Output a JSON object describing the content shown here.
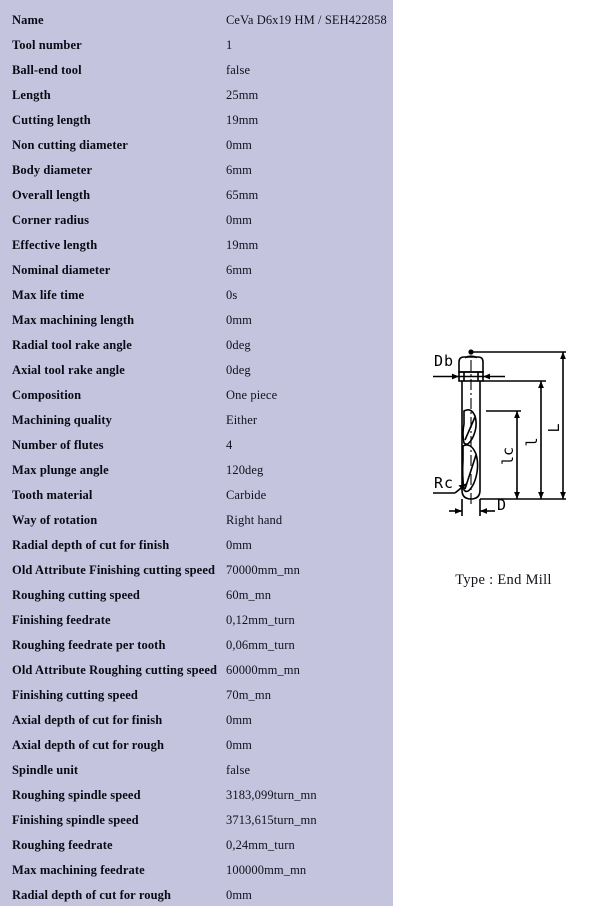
{
  "table": {
    "rows": [
      {
        "label": "Name",
        "value": "CeVa D6x19 HM / SEH422858"
      },
      {
        "label": "Tool number",
        "value": "1"
      },
      {
        "label": "Ball-end tool",
        "value": "false"
      },
      {
        "label": "Length",
        "value": "25mm"
      },
      {
        "label": "Cutting length",
        "value": "19mm"
      },
      {
        "label": "Non cutting diameter",
        "value": "0mm"
      },
      {
        "label": "Body diameter",
        "value": "6mm"
      },
      {
        "label": "Overall length",
        "value": "65mm"
      },
      {
        "label": "Corner radius",
        "value": "0mm"
      },
      {
        "label": "Effective length",
        "value": "19mm"
      },
      {
        "label": "Nominal diameter",
        "value": "6mm"
      },
      {
        "label": "Max life time",
        "value": "0s"
      },
      {
        "label": "Max machining length",
        "value": "0mm"
      },
      {
        "label": "Radial tool rake angle",
        "value": "0deg"
      },
      {
        "label": "Axial tool rake angle",
        "value": "0deg"
      },
      {
        "label": "Composition",
        "value": "One piece"
      },
      {
        "label": "Machining quality",
        "value": "Either"
      },
      {
        "label": "Number of flutes",
        "value": "4"
      },
      {
        "label": "Max plunge angle",
        "value": "120deg"
      },
      {
        "label": "Tooth material",
        "value": "Carbide"
      },
      {
        "label": "Way of rotation",
        "value": "Right hand"
      },
      {
        "label": "Radial depth of cut for finish",
        "value": "0mm"
      },
      {
        "label": "Old Attribute Finishing cutting speed",
        "value": "70000mm_mn"
      },
      {
        "label": "Roughing cutting speed",
        "value": "60m_mn"
      },
      {
        "label": "Finishing feedrate",
        "value": "0,12mm_turn"
      },
      {
        "label": "Roughing feedrate per tooth",
        "value": "0,06mm_turn"
      },
      {
        "label": "Old Attribute Roughing cutting speed",
        "value": "60000mm_mn"
      },
      {
        "label": "Finishing cutting speed",
        "value": "70m_mn"
      },
      {
        "label": "Axial depth of cut for finish",
        "value": "0mm"
      },
      {
        "label": "Axial depth of cut for rough",
        "value": "0mm"
      },
      {
        "label": "Spindle unit",
        "value": "false"
      },
      {
        "label": "Roughing spindle speed",
        "value": "3183,099turn_mn"
      },
      {
        "label": "Finishing spindle speed",
        "value": "3713,615turn_mn"
      },
      {
        "label": "Roughing feedrate",
        "value": "0,24mm_turn"
      },
      {
        "label": "Max machining feedrate",
        "value": "100000mm_mn"
      },
      {
        "label": "Radial depth of cut for rough",
        "value": "0mm"
      }
    ]
  },
  "drawing": {
    "caption": "Type : End Mill",
    "dimension_labels": {
      "body_diameter": "Db",
      "corner_radius": "Rc",
      "nominal_diameter": "D",
      "cutting_length": "lc",
      "length": "l",
      "overall_length": "L"
    }
  },
  "colors": {
    "table_background": "#c4c4de",
    "page_background": "#ffffff",
    "text": "#0a0a14",
    "line": "#000000"
  }
}
